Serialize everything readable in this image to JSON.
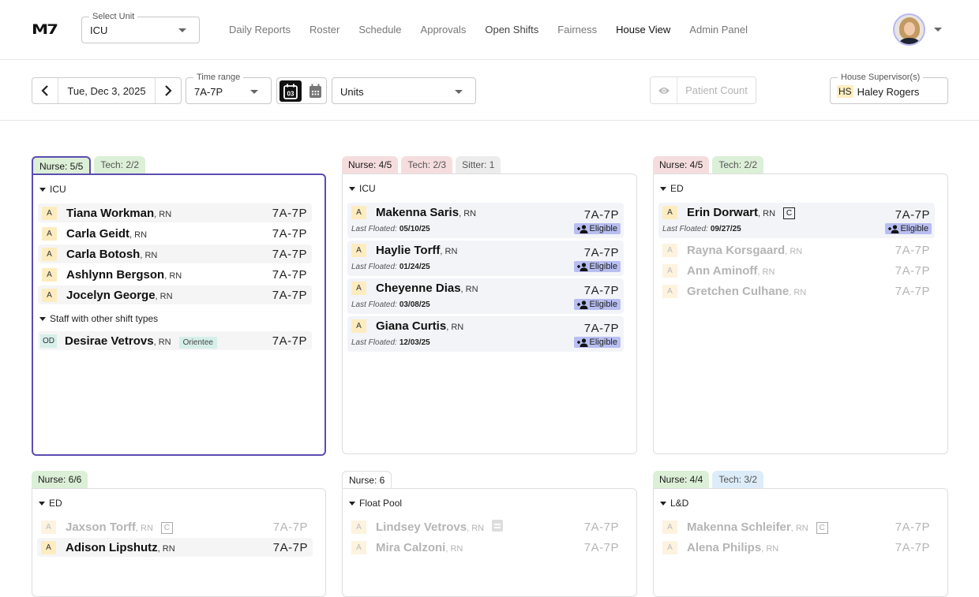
{
  "app": {
    "logo": "M7",
    "unit_select": {
      "label": "Select Unit",
      "value": "ICU"
    },
    "nav": [
      "Daily Reports",
      "Roster",
      "Schedule",
      "Approvals",
      "Open Shifts",
      "Fairness",
      "House View",
      "Admin Panel"
    ],
    "nav_active": "House View",
    "avatar_alt": "user-avatar"
  },
  "toolbar": {
    "date": "Tue, Dec 3, 2025",
    "time_range": {
      "label": "Time range",
      "value": "7A-7P"
    },
    "calendar_day": "03",
    "units": {
      "value": "Units"
    },
    "patient_count": "Patient Count",
    "supervisor": {
      "label": "House Supervisor(s)",
      "initials": "HS",
      "name": "Haley Rogers"
    }
  },
  "cards": [
    {
      "tabs": [
        {
          "label": "Nurse: 5/5",
          "color": "green",
          "active": true
        },
        {
          "label": "Tech: 2/2",
          "color": "green"
        }
      ],
      "group": "ICU",
      "rows": [
        {
          "badge": "A",
          "name": "Tiana Workman",
          "cred": "RN",
          "time": "7A-7P"
        },
        {
          "badge": "A",
          "name": "Carla Geidt",
          "cred": "RN",
          "time": "7A-7P"
        },
        {
          "badge": "A",
          "name": "Carla Botosh",
          "cred": "RN",
          "time": "7A-7P"
        },
        {
          "badge": "A",
          "name": "Ashlynn Bergson",
          "cred": "RN",
          "time": "7A-7P"
        },
        {
          "badge": "A",
          "name": "Jocelyn George",
          "cred": "RN",
          "time": "7A-7P"
        }
      ],
      "subgroup": "Staff with other shift types",
      "subrows": [
        {
          "badge": "OD",
          "name": "Desirae Vetrovs",
          "cred": "RN",
          "tag": "Orientee",
          "time": "7A-7P"
        }
      ]
    },
    {
      "tabs": [
        {
          "label": "Nurse: 4/5",
          "color": "red",
          "active": true
        },
        {
          "label": "Tech: 2/3",
          "color": "red"
        },
        {
          "label": "Sitter: 1",
          "color": "gray"
        }
      ],
      "group": "ICU",
      "last_floated_label": "Last Floated:",
      "eligible_label": "Eligible",
      "rows": [
        {
          "badge": "A",
          "name": "Makenna Saris",
          "cred": "RN",
          "time": "7A-7P",
          "last_floated": "05/10/25"
        },
        {
          "badge": "A",
          "name": "Haylie Torff",
          "cred": "RN",
          "time": "7A-7P",
          "last_floated": "01/24/25"
        },
        {
          "badge": "A",
          "name": "Cheyenne Dias",
          "cred": "RN",
          "time": "7A-7P",
          "last_floated": "03/08/25"
        },
        {
          "badge": "A",
          "name": "Giana Curtis",
          "cred": "RN",
          "time": "7A-7P",
          "last_floated": "12/03/25"
        }
      ]
    },
    {
      "tabs": [
        {
          "label": "Nurse: 4/5",
          "color": "red",
          "active": true
        },
        {
          "label": "Tech: 2/2",
          "color": "green"
        }
      ],
      "group": "ED",
      "rows": [
        {
          "badge": "A",
          "name": "Erin Dorwart",
          "cred": "RN",
          "charge": "C",
          "time": "7A-7P",
          "last_floated": "09/27/25"
        },
        {
          "badge": "A",
          "name": "Rayna Korsgaard",
          "cred": "RN",
          "time": "7A-7P"
        },
        {
          "badge": "A",
          "name": "Ann Aminoff",
          "cred": "RN",
          "time": "7A-7P"
        },
        {
          "badge": "A",
          "name": "Gretchen Culhane",
          "cred": "RN",
          "time": "7A-7P"
        }
      ]
    },
    {
      "tabs": [
        {
          "label": "Nurse: 6/6",
          "color": "green",
          "active": true
        }
      ],
      "group": "ED",
      "rows": [
        {
          "badge": "A",
          "name": "Jaxson Torff",
          "cred": "RN",
          "charge": "C",
          "time": "7A-7P"
        },
        {
          "badge": "A",
          "name": "Adison Lipshutz",
          "cred": "RN",
          "time": "7A-7P"
        }
      ]
    },
    {
      "tabs": [
        {
          "label": "Nurse: 6",
          "color": "white",
          "active": true
        }
      ],
      "group": "Float Pool",
      "rows": [
        {
          "badge": "A",
          "name": "Lindsey Vetrovs",
          "cred": "RN",
          "time": "7A-7P",
          "note": true
        },
        {
          "badge": "A",
          "name": "Mira Calzoni",
          "cred": "RN",
          "time": "7A-7P"
        }
      ]
    },
    {
      "tabs": [
        {
          "label": "Nurse: 4/4",
          "color": "green",
          "active": true
        },
        {
          "label": "Tech: 3/2",
          "color": "blue"
        }
      ],
      "group": "L&D",
      "rows": [
        {
          "badge": "A",
          "name": "Makenna Schleifer",
          "cred": "RN",
          "charge": "C",
          "time": "7A-7P"
        },
        {
          "badge": "A",
          "name": "Alena Philips",
          "cred": "RN",
          "time": "7A-7P"
        }
      ]
    }
  ]
}
